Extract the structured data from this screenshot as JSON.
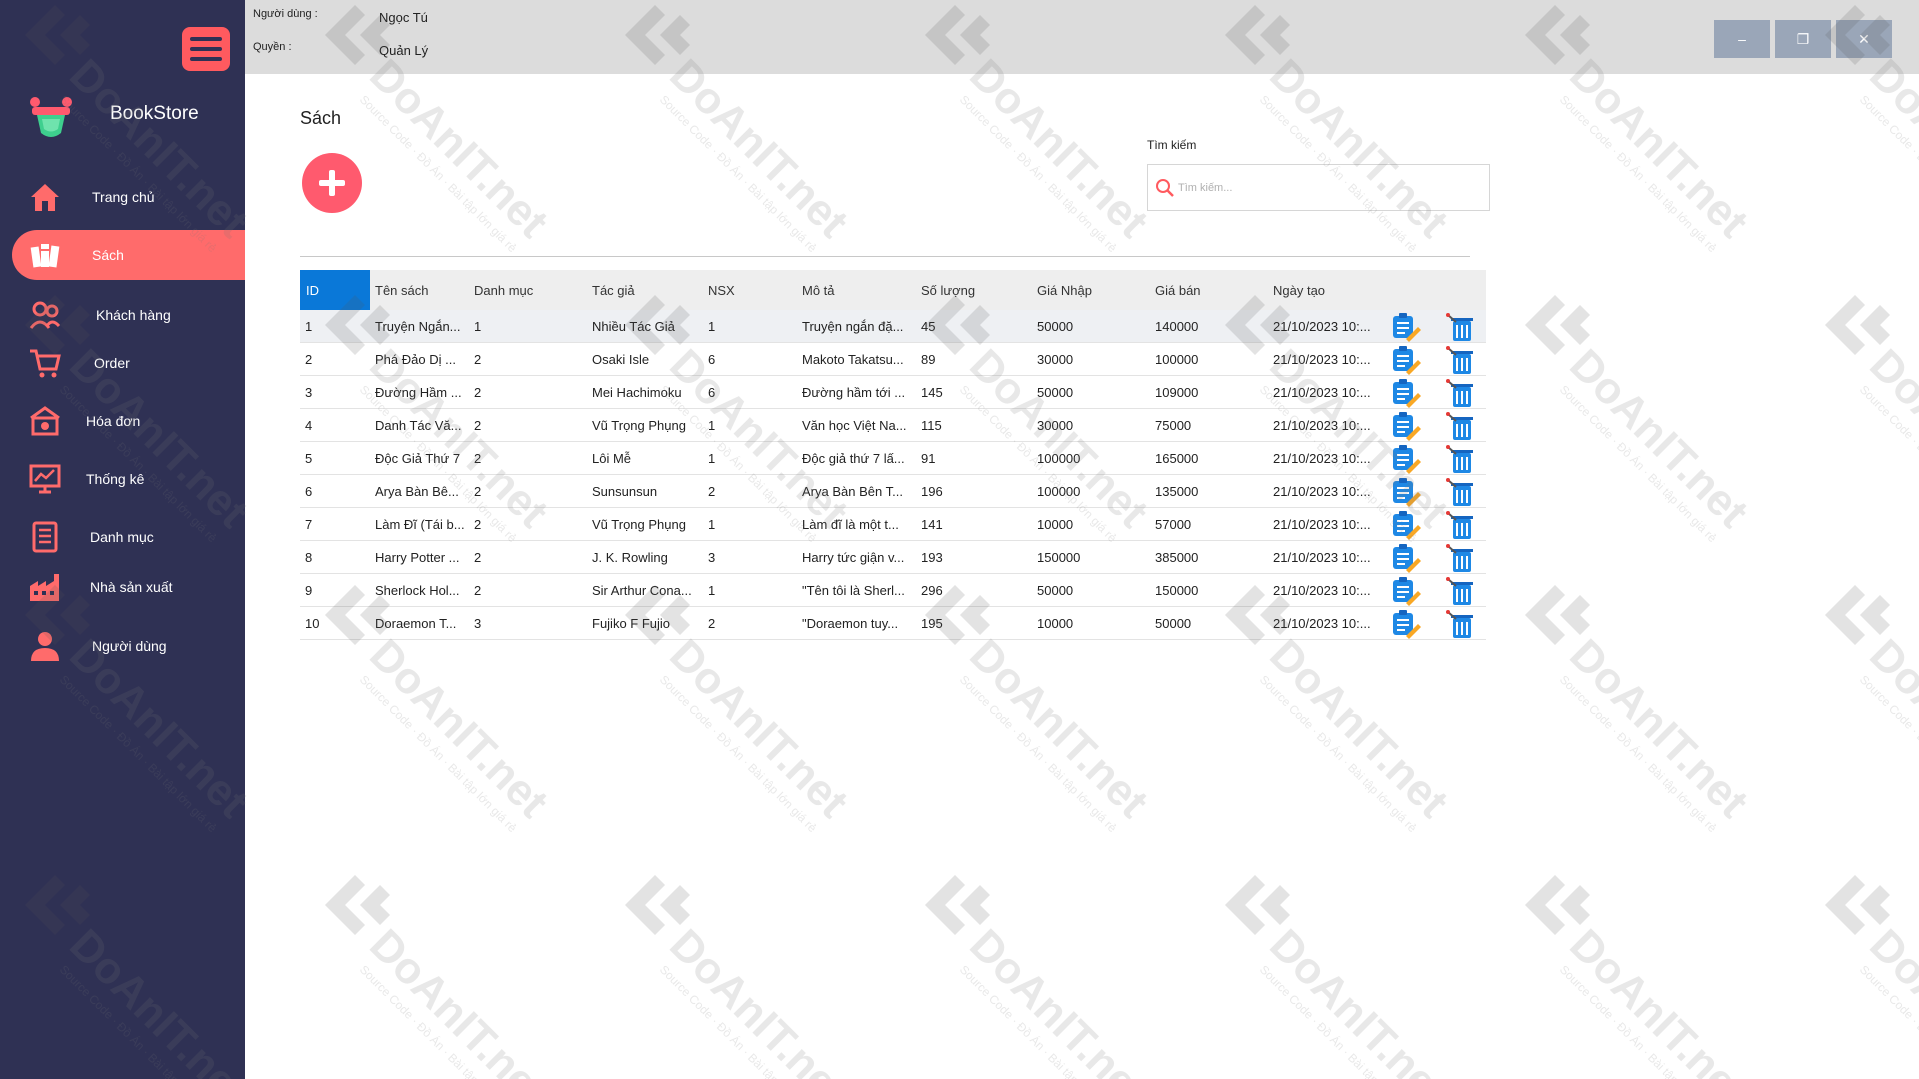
{
  "app": {
    "name": "BookStore"
  },
  "header": {
    "user_label": "Người dùng :",
    "user_value": "Ngọc Tú",
    "role_label": "Quyền :",
    "role_value": "Quản Lý",
    "window_controls": {
      "minimize": "–",
      "restore": "❐",
      "close": "✕"
    }
  },
  "sidebar": {
    "items": [
      {
        "label": "Trang chủ",
        "icon": "home-icon",
        "active": false
      },
      {
        "label": "Sách",
        "icon": "books-icon",
        "active": true
      },
      {
        "label": "Khách hàng",
        "icon": "customers-icon",
        "active": false
      },
      {
        "label": "Order",
        "icon": "cart-icon",
        "active": false
      },
      {
        "label": "Hóa đơn",
        "icon": "invoice-icon",
        "active": false
      },
      {
        "label": "Thống kê",
        "icon": "chart-icon",
        "active": false
      },
      {
        "label": "Danh mục",
        "icon": "list-icon",
        "active": false
      },
      {
        "label": "Nhà sản xuất",
        "icon": "factory-icon",
        "active": false
      },
      {
        "label": "Người dùng",
        "icon": "user-icon",
        "active": false
      }
    ]
  },
  "main": {
    "title": "Sách",
    "search": {
      "label": "Tìm kiếm",
      "placeholder": "Tìm kiếm...",
      "value": ""
    },
    "table": {
      "columns": [
        "ID",
        "Tên sách",
        "Danh mục",
        "Tác giả",
        "NSX",
        "Mô tả",
        "Số lượng",
        "Giá Nhập",
        "Giá bán",
        "Ngày tạo"
      ],
      "rows": [
        [
          "1",
          "Truyện Ngắn...",
          "1",
          "Nhiều Tác Giả",
          "1",
          "Truyện ngắn đặ...",
          "45",
          "50000",
          "140000",
          "21/10/2023 10:..."
        ],
        [
          "2",
          "Phá Đảo Dị ...",
          "2",
          "Osaki Isle",
          "6",
          "Makoto Takatsu...",
          "89",
          "30000",
          "100000",
          "21/10/2023 10:..."
        ],
        [
          "3",
          "Đường Hầm ...",
          "2",
          "Mei Hachimoku",
          "6",
          "Đường hầm tới ...",
          "145",
          "50000",
          "109000",
          "21/10/2023 10:..."
        ],
        [
          "4",
          "Danh Tác Vă...",
          "2",
          "Vũ Trọng Phụng",
          "1",
          "Văn học Việt Na...",
          "115",
          "30000",
          "75000",
          "21/10/2023 10:..."
        ],
        [
          "5",
          "Độc Giả Thứ 7",
          "2",
          "Lôi Mễ",
          "1",
          "Độc giả thứ 7 lấ...",
          "91",
          "100000",
          "165000",
          "21/10/2023 10:..."
        ],
        [
          "6",
          "Arya Bàn Bê...",
          "2",
          "Sunsunsun",
          "2",
          "Arya Bàn Bên T...",
          "196",
          "100000",
          "135000",
          "21/10/2023 10:..."
        ],
        [
          "7",
          "Làm Đĩ (Tái b...",
          "2",
          "Vũ Trọng Phụng",
          "1",
          "Làm đĩ là một t...",
          "141",
          "10000",
          "57000",
          "21/10/2023 10:..."
        ],
        [
          "8",
          "Harry Potter ...",
          "2",
          "J. K. Rowling",
          "3",
          "Harry tức giận v...",
          "193",
          "150000",
          "385000",
          "21/10/2023 10:..."
        ],
        [
          "9",
          "Sherlock Hol...",
          "2",
          "Sir Arthur Cona...",
          "1",
          "\"Tên tôi là Sherl...",
          "296",
          "50000",
          "150000",
          "21/10/2023 10:..."
        ],
        [
          "10",
          "Doraemon T...",
          "3",
          "Fujiko F Fujio",
          "2",
          "\"Doraemon tuy...",
          "195",
          "10000",
          "50000",
          "21/10/2023 10:..."
        ]
      ]
    }
  },
  "watermark": {
    "main": "DoAnIT.net",
    "sub": "Source Code · Đồ Án · Bài tập lớn giá rẻ"
  },
  "colors": {
    "sidebar": "#2f3154",
    "accent": "#ff6b6b",
    "header_selected": "#0a78d8",
    "topbar": "#dcdcdc"
  }
}
